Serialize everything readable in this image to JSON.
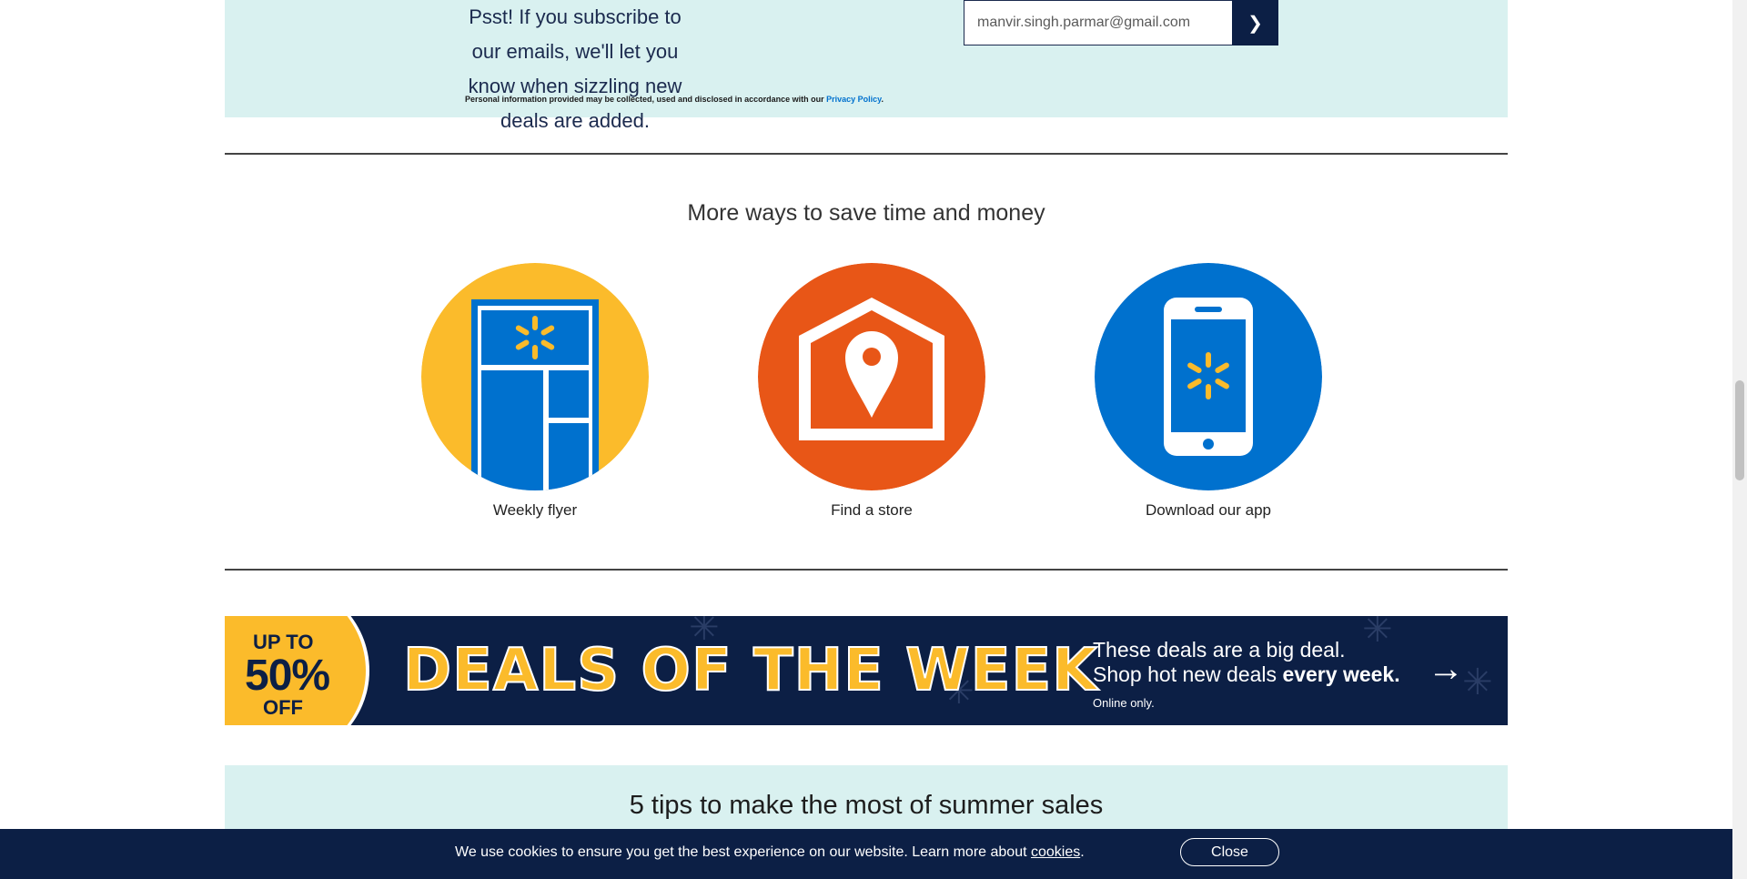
{
  "subscribe": {
    "message": "Psst! If you subscribe to our emails, we'll let you know when sizzling new deals are added.",
    "email_value": "manvir.singh.parmar@gmail.com",
    "submit_icon": "chevron-right-icon",
    "submit_glyph": "❯",
    "privacy_prefix": "Personal information provided may be collected, used and disclosed in accordance with our",
    "privacy_link": "Privacy Policy",
    "privacy_suffix": "."
  },
  "more_ways": {
    "title": "More ways to save time and money",
    "items": [
      {
        "label": "Weekly flyer",
        "icon": "weekly-flyer-icon",
        "color": "#fbbb2b"
      },
      {
        "label": "Find a store",
        "icon": "find-store-icon",
        "color": "#e85617"
      },
      {
        "label": "Download our app",
        "icon": "mobile-app-icon",
        "color": "#0071ce"
      }
    ]
  },
  "deals_banner": {
    "badge_line1": "UP TO",
    "badge_line2": "50%",
    "badge_line3": "OFF",
    "headline": "DEALS OF THE WEEK",
    "tagline1": "These deals are a big deal.",
    "tagline2_prefix": "Shop hot new deals",
    "tagline2_bold": "every week.",
    "note": "Online only.",
    "arrow_glyph": "→"
  },
  "tips": {
    "title": "5 tips to make the most of summer sales"
  },
  "cookie_bar": {
    "message": "We use cookies to ensure you get the best experience on our website. Learn more about",
    "link": "cookies",
    "suffix": ".",
    "close_label": "Close"
  },
  "colors": {
    "mint": "#d9f1f0",
    "navy": "#0c1f45",
    "yellow": "#fbbb2b",
    "orange": "#e85617",
    "blue": "#0071ce"
  }
}
